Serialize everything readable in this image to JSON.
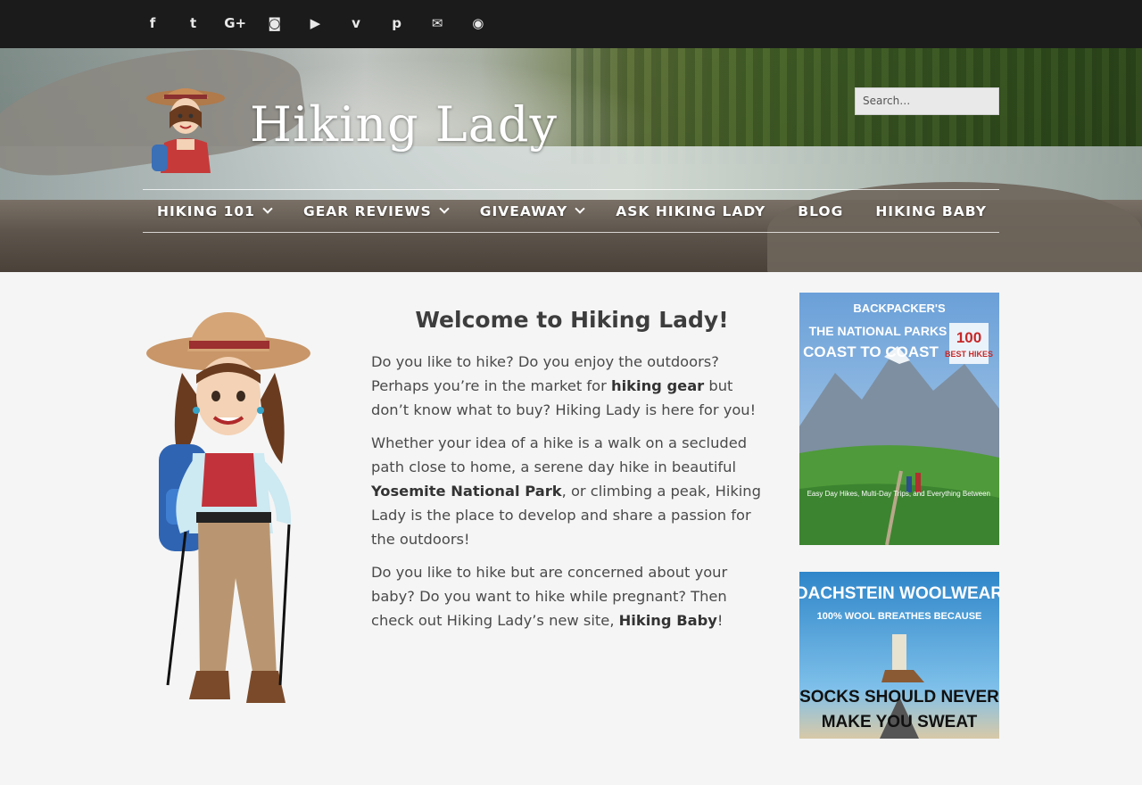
{
  "social_icons": [
    {
      "name": "facebook-icon",
      "glyph": "f"
    },
    {
      "name": "twitter-icon",
      "glyph": "t"
    },
    {
      "name": "google-plus-icon",
      "glyph": "G+"
    },
    {
      "name": "instagram-icon",
      "glyph": "◙"
    },
    {
      "name": "youtube-icon",
      "glyph": "▶"
    },
    {
      "name": "vimeo-icon",
      "glyph": "v"
    },
    {
      "name": "pinterest-icon",
      "glyph": "p"
    },
    {
      "name": "email-icon",
      "glyph": "✉"
    },
    {
      "name": "rss-icon",
      "glyph": "◉"
    }
  ],
  "header": {
    "site_title": "Hiking Lady",
    "search_placeholder": "Search…"
  },
  "nav": [
    {
      "label": "HIKING 101",
      "has_dropdown": true
    },
    {
      "label": "GEAR REVIEWS",
      "has_dropdown": true
    },
    {
      "label": "GIVEAWAY",
      "has_dropdown": true
    },
    {
      "label": "ASK HIKING LADY",
      "has_dropdown": false
    },
    {
      "label": "BLOG",
      "has_dropdown": false
    },
    {
      "label": "HIKING BABY",
      "has_dropdown": false
    }
  ],
  "main": {
    "heading": "Welcome to Hiking Lady!",
    "p1_a": "Do you like to hike? Do you enjoy the outdoors? Perhaps you’re in the market for ",
    "p1_link": "hiking gear",
    "p1_b": " but don’t know what to buy?  Hiking Lady is here for you!",
    "p2_a": "Whether your idea of a hike is a walk on a secluded path close to home, a serene day hike in beautiful ",
    "p2_link": "Yosemite National Park",
    "p2_b": ", or climbing a peak, Hiking Lady is the place to develop and share a passion for the outdoors!",
    "p3_a": "Do you like to hike but are concerned about your baby? Do you want to hike while pregnant? Then check out Hiking Lady’s new site, ",
    "p3_link": "Hiking Baby",
    "p3_b": "!"
  },
  "ads": {
    "ad1": {
      "brand": "BACKPACKER'S",
      "line1": "THE NATIONAL PARKS",
      "line2": "COAST TO COAST",
      "badge_num": "100",
      "badge_text": "BEST HIKES",
      "tagline": "Easy Day Hikes, Multi-Day Trips, and Everything Between"
    },
    "ad2": {
      "brand": "DACHSTEIN WOOLWEAR",
      "sub": "100% WOOL BREATHES BECAUSE",
      "line1": "SOCKS SHOULD NEVER",
      "line2": "MAKE YOU SWEAT"
    }
  },
  "colors": {
    "topbar": "#1b1b1b",
    "nav_text": "#ffffff",
    "body_bg": "#f5f5f5",
    "text": "#4a4a4a"
  }
}
